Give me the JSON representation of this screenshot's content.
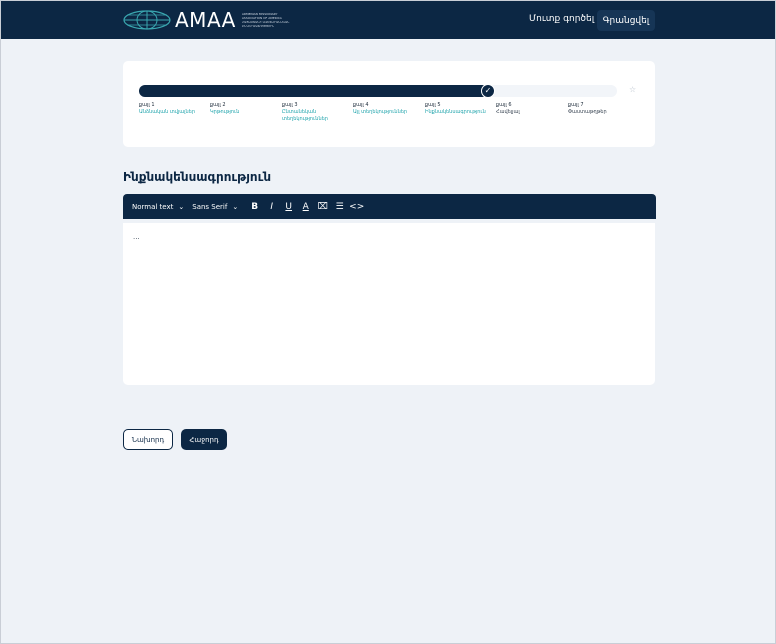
{
  "header": {
    "logo_text": "AMAA",
    "logo_tagline": [
      "ARMENIAN MISSIONARY",
      "ASSOCIATION OF AMERICA",
      "ՀԱՅԱՍՏԱՆԻ ԱՎԵՏԱՐԱՆԱԿԱՆ",
      "ԸՆԿԵՐԱԿՑՈՒԹՅՈՒՆ"
    ],
    "login_label": "Մուտք գործել",
    "register_label": "Գրանցվել"
  },
  "stepper": {
    "progress_fraction": 0.73,
    "steps": [
      {
        "num": "քայլ 1",
        "name": "Անձնական տվյալներ",
        "state": "done"
      },
      {
        "num": "քայլ 2",
        "name": "Կրթություն",
        "state": "done"
      },
      {
        "num": "քայլ 3",
        "name": "Ընտանեկան տեղեկություններ",
        "state": "done"
      },
      {
        "num": "քայլ 4",
        "name": "Այլ տեղեկություններ",
        "state": "done"
      },
      {
        "num": "քայլ 5",
        "name": "Ինքնակենսագրություն",
        "state": "current"
      },
      {
        "num": "քայլ 6",
        "name": "Հավելյալ",
        "state": "pending"
      },
      {
        "num": "քայլ 7",
        "name": "Փաստաթղթեր",
        "state": "pending"
      }
    ],
    "check_icon": "check-icon",
    "end_icon": "star-icon"
  },
  "section_title": "Ինքնակենսագրություն",
  "toolbar": {
    "format_select": "Normal text",
    "font_select": "Sans Serif",
    "bold": "B",
    "italic": "I",
    "underline": "U",
    "font_color": "A",
    "clean": "⌧",
    "list": "☰",
    "code": "<>"
  },
  "editor": {
    "content": "..."
  },
  "buttons": {
    "prev_label": "Նախորդ",
    "next_label": "Հաջորդ"
  },
  "colors": {
    "navy": "#0c2744",
    "teal": "#22a5ad",
    "background": "#eef2f7"
  }
}
